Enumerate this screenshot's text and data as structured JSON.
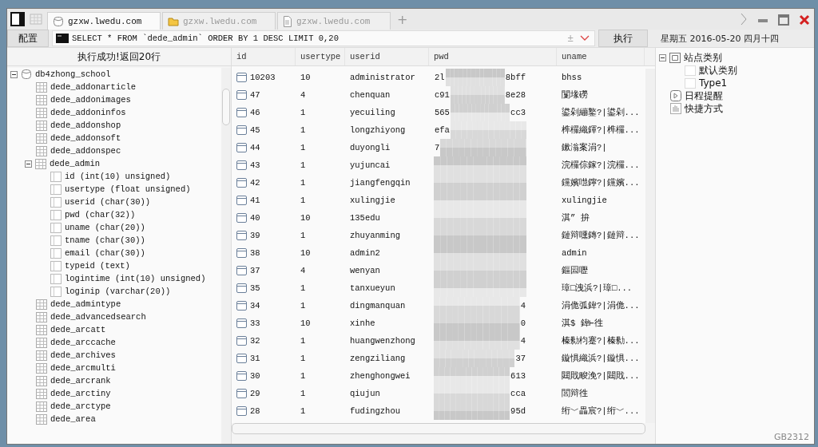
{
  "tabs": [
    {
      "label": "gzxw.lwedu.com",
      "kind": "database",
      "selected": true
    },
    {
      "label": "gzxw.lwedu.com",
      "kind": "folder",
      "selected": false
    },
    {
      "label": "gzxw.lwedu.com",
      "kind": "document",
      "selected": false
    }
  ],
  "new_tab": "+",
  "toolbar": {
    "config_button": "配置",
    "query": "SELECT * FROM `dede_admin` ORDER BY 1 DESC LIMIT 0,20",
    "toggle": "±",
    "run_button": "执行",
    "date": "星期五 2016-05-20 四月十四"
  },
  "tree": {
    "status": "执行成功!返回20行",
    "items": [
      {
        "label": "db4zhong_school",
        "kind": "database",
        "expanded": true,
        "children": [
          {
            "label": "dede_addonarticle",
            "kind": "table"
          },
          {
            "label": "dede_addonimages",
            "kind": "table"
          },
          {
            "label": "dede_addoninfos",
            "kind": "table"
          },
          {
            "label": "dede_addonshop",
            "kind": "table"
          },
          {
            "label": "dede_addonsoft",
            "kind": "table"
          },
          {
            "label": "dede_addonspec",
            "kind": "table"
          },
          {
            "label": "dede_admin",
            "kind": "table",
            "expanded": true,
            "children": [
              {
                "label": "id (int(10) unsigned)",
                "kind": "column"
              },
              {
                "label": "usertype (float unsigned)",
                "kind": "column"
              },
              {
                "label": "userid (char(30))",
                "kind": "column"
              },
              {
                "label": "pwd (char(32))",
                "kind": "column"
              },
              {
                "label": "uname (char(20))",
                "kind": "column"
              },
              {
                "label": "tname (char(30))",
                "kind": "column"
              },
              {
                "label": "email (char(30))",
                "kind": "column"
              },
              {
                "label": "typeid (text)",
                "kind": "column"
              },
              {
                "label": "logintime (int(10) unsigned)",
                "kind": "column"
              },
              {
                "label": "loginip (varchar(20))",
                "kind": "column"
              }
            ]
          },
          {
            "label": "dede_admintype",
            "kind": "table"
          },
          {
            "label": "dede_advancedsearch",
            "kind": "table"
          },
          {
            "label": "dede_arcatt",
            "kind": "table"
          },
          {
            "label": "dede_arccache",
            "kind": "table"
          },
          {
            "label": "dede_archives",
            "kind": "table"
          },
          {
            "label": "dede_arcmulti",
            "kind": "table"
          },
          {
            "label": "dede_arcrank",
            "kind": "table"
          },
          {
            "label": "dede_arctiny",
            "kind": "table"
          },
          {
            "label": "dede_arctype",
            "kind": "table"
          },
          {
            "label": "dede_area",
            "kind": "table"
          }
        ]
      }
    ]
  },
  "grid": {
    "columns": [
      "id",
      "usertype",
      "userid",
      "pwd",
      "uname"
    ],
    "rows": [
      {
        "id": "10203",
        "usertype": "10",
        "userid": "administrator",
        "pwd_head": "2l",
        "pwd_tail": "8bff",
        "uname": "bhss"
      },
      {
        "id": "47",
        "usertype": "4",
        "userid": "chenquan",
        "pwd_head": "c91",
        "pwd_tail": "8e28",
        "uname": "闅堟磱"
      },
      {
        "id": "46",
        "usertype": "1",
        "userid": "yecuiling",
        "pwd_head": "565",
        "pwd_tail": "cc3",
        "uname": "鍙剁繃鐜?|鍙剁..."
      },
      {
        "id": "45",
        "usertype": "1",
        "userid": "longzhiyong",
        "pwd_head": "efa",
        "uname": "榫欏織鍕?|榫欏..."
      },
      {
        "id": "44",
        "usertype": "1",
        "userid": "duyongli",
        "pwd_head": "7",
        "uname": "鏉滃案涓?|"
      },
      {
        "id": "43",
        "usertype": "1",
        "userid": "yujuncai",
        "uname": "浣欏倧鎵?|浣欏..."
      },
      {
        "id": "42",
        "usertype": "1",
        "userid": "jiangfengqin",
        "uname": "钂嬪嚖鑏?|钂嬪..."
      },
      {
        "id": "41",
        "usertype": "1",
        "userid": "xulingjie",
        "uname": "xulingjie"
      },
      {
        "id": "40",
        "usertype": "10",
        "userid": "135edu",
        "uname": "淇” 拚"
      },
      {
        "id": "39",
        "usertype": "1",
        "userid": "zhuyanming",
        "uname": "鏈辩嚑鏄?|鏈辩..."
      },
      {
        "id": "38",
        "usertype": "10",
        "userid": "admin2",
        "uname": "admin"
      },
      {
        "id": "37",
        "usertype": "4",
        "userid": "wenyan",
        "uname": "鏂囩嚦"
      },
      {
        "id": "35",
        "usertype": "1",
        "userid": "tanxueyun",
        "uname": "璋□洩浜?|璋□..."
      },
      {
        "id": "34",
        "usertype": "1",
        "userid": "dingmanquan",
        "pwd_tail": "4",
        "uname": "涓佹弧鍏?|涓佹..."
      },
      {
        "id": "33",
        "usertype": "10",
        "userid": "xinhe",
        "pwd_tail": "0",
        "uname": "淇$  鍏⊢徃"
      },
      {
        "id": "32",
        "usertype": "1",
        "userid": "huangwenzhong",
        "pwd_tail": "4",
        "uname": "榛勬枃蹇?|榛勬..."
      },
      {
        "id": "31",
        "usertype": "1",
        "userid": "zengziliang",
        "pwd_tail": "37",
        "uname": "鏇惧織浜?|鏇惧..."
      },
      {
        "id": "30",
        "usertype": "1",
        "userid": "zhenghongwei",
        "pwd_tail": "613",
        "uname": "閮戝畯浼?|閮戝..."
      },
      {
        "id": "29",
        "usertype": "1",
        "userid": "qiujun",
        "pwd_tail": "cca",
        "uname": "閭辩徃"
      },
      {
        "id": "28",
        "usertype": "1",
        "userid": "fudingzhou",
        "pwd_tail": "95d",
        "uname": "绗﹀畾宸?|绗﹀..."
      }
    ]
  },
  "side_tree": [
    {
      "label": "站点类别",
      "kind": "category",
      "expanded": true,
      "children": [
        {
          "label": "默认类别",
          "kind": "entry"
        },
        {
          "label": "Type1",
          "kind": "entry"
        }
      ]
    },
    {
      "label": "日程提醒",
      "kind": "schedule"
    },
    {
      "label": "快捷方式",
      "kind": "shortcut"
    }
  ],
  "status_bar": {
    "encoding": "GB2312"
  }
}
